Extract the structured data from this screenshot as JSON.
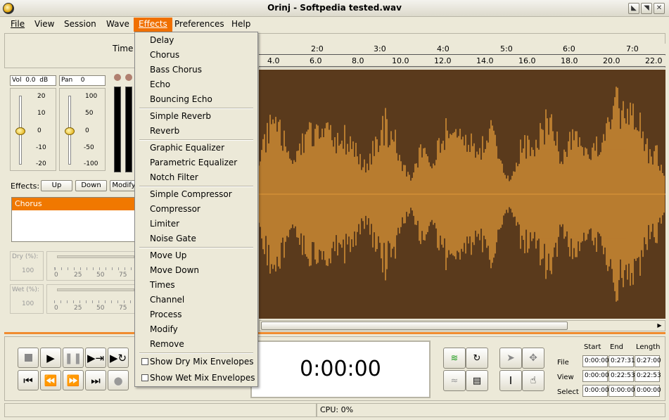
{
  "window": {
    "title": "Orinj - Softpedia tested.wav",
    "buttons": [
      "minimize",
      "maximize",
      "close"
    ]
  },
  "menubar": {
    "items": [
      {
        "label": "File",
        "active": false
      },
      {
        "label": "View",
        "active": false
      },
      {
        "label": "Session",
        "active": false
      },
      {
        "label": "Wave",
        "active": false
      },
      {
        "label": "Effects",
        "active": true
      },
      {
        "label": "Preferences",
        "active": false
      },
      {
        "label": "Help",
        "active": false
      }
    ]
  },
  "effects_menu": {
    "groups": [
      [
        "Delay",
        "Chorus",
        "Bass Chorus",
        "Echo",
        "Bouncing Echo"
      ],
      [
        "Simple Reverb",
        "Reverb"
      ],
      [
        "Graphic Equalizer",
        "Parametric Equalizer",
        "Notch Filter"
      ],
      [
        "Simple Compressor",
        "Compressor",
        "Limiter",
        "Noise Gate"
      ],
      [
        "Move Up",
        "Move Down",
        "Times",
        "Channel",
        "Process",
        "Modify",
        "Remove"
      ],
      [
        "Show Dry Mix Envelopes",
        "Show Wet Mix Envelopes"
      ]
    ]
  },
  "timeline": {
    "label": "Time",
    "top_ticks": [
      "2:0",
      "3:0",
      "4:0",
      "5:0",
      "6:0",
      "7:0"
    ],
    "bottom_ticks": [
      "4.0",
      "6.0",
      "8.0",
      "10.0",
      "12.0",
      "14.0",
      "16.0",
      "18.0",
      "20.0",
      "22.0"
    ]
  },
  "mixer": {
    "vol_label": "Vol",
    "vol_value": "0.0",
    "vol_unit": "dB",
    "pan_label": "Pan",
    "pan_value": "0",
    "vol_scale": [
      "20",
      "10",
      "0",
      "-10",
      "-20"
    ],
    "pan_scale": [
      "100",
      "50",
      "0",
      "-50",
      "-100"
    ],
    "effects_label": "Effects:",
    "effects_buttons": [
      "Up",
      "Down",
      "Modify"
    ],
    "selected_effect": "Chorus",
    "dry_label": "Dry (%):",
    "dry_value": "100",
    "wet_label": "Wet (%):",
    "wet_value": "100",
    "mix_scale": [
      "0",
      "25",
      "50",
      "75"
    ]
  },
  "transport": {
    "time": "0:00:00",
    "buttons": [
      "stop",
      "play",
      "pause",
      "play-to-end",
      "loop",
      "go-start",
      "rewind",
      "fast-forward",
      "go-end",
      "record"
    ]
  },
  "selection": {
    "headers": [
      "Start",
      "End",
      "Length"
    ],
    "rows": [
      {
        "label": "File",
        "start": "0:00:00",
        "end": "0:27:31",
        "length": "0:27:00"
      },
      {
        "label": "View",
        "start": "0:00:00",
        "end": "0:22:53",
        "length": "0:22:53"
      },
      {
        "label": "Select",
        "start": "0:00:00",
        "end": "0:00:00",
        "length": "0:00:00"
      }
    ]
  },
  "status": {
    "cpu": "CPU: 0%"
  },
  "colors": {
    "accent": "#f07800",
    "wave_bg": "#5a3a1c",
    "wave_fg": "#e09838"
  }
}
